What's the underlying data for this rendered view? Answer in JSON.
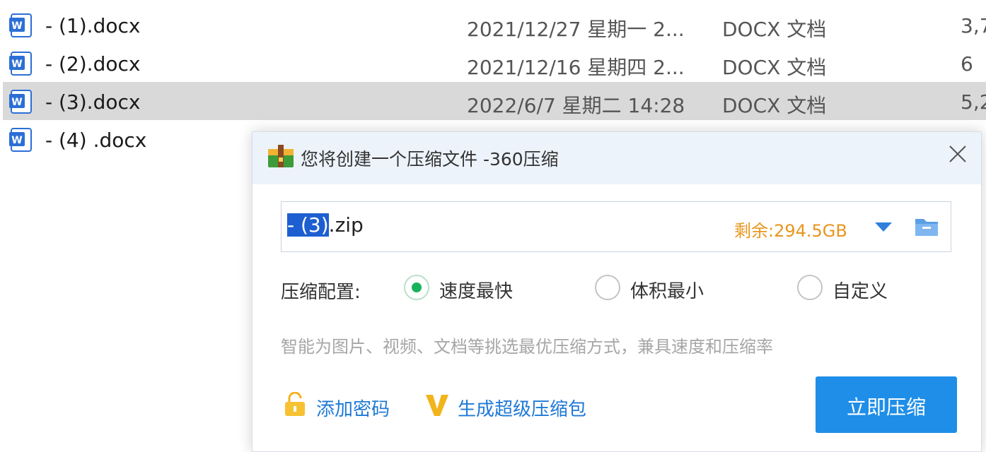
{
  "files": [
    {
      "name": "- (1).docx",
      "date": "2021/12/27 星期一 2...",
      "type": "DOCX 文档",
      "size": "3,7",
      "selected": false
    },
    {
      "name": "- (2).docx",
      "date": "2021/12/16 星期四 2...",
      "type": "DOCX 文档",
      "size": "6",
      "selected": false
    },
    {
      "name": "- (3).docx",
      "date": "2022/6/7 星期二 14:28",
      "type": "DOCX 文档",
      "size": "5,2",
      "selected": true
    },
    {
      "name": "- (4) .docx",
      "date": "",
      "type": "",
      "size": "",
      "selected": false
    }
  ],
  "dialog": {
    "title": "您将创建一个压缩文件 -360压缩",
    "path": {
      "selected_part": "- (3)",
      "rest": ".zip",
      "free_space": "剩余:294.5GB"
    },
    "config": {
      "label": "压缩配置:",
      "options": [
        {
          "label": "速度最快",
          "checked": true
        },
        {
          "label": "体积最小",
          "checked": false
        },
        {
          "label": "自定义",
          "checked": false
        }
      ]
    },
    "hint": "智能为图片、视频、文档等挑选最优压缩方式，兼具速度和压缩率",
    "add_password": "添加密码",
    "super_package": "生成超级压缩包",
    "compress_button": "立即压缩"
  },
  "colors": {
    "accent": "#1e8ee8",
    "link": "#1e79d6",
    "free_space": "#e8961e",
    "radio_checked": "#18b25c",
    "selection": "#1d5fd1",
    "row_selected": "#d9d9d9"
  },
  "icons": {
    "file": "word-doc-icon",
    "app": "360zip-app-icon",
    "close": "close-icon",
    "dropdown": "chevron-down-icon",
    "folder": "folder-icon",
    "lock": "unlock-icon",
    "vip": "vip-v-icon"
  }
}
